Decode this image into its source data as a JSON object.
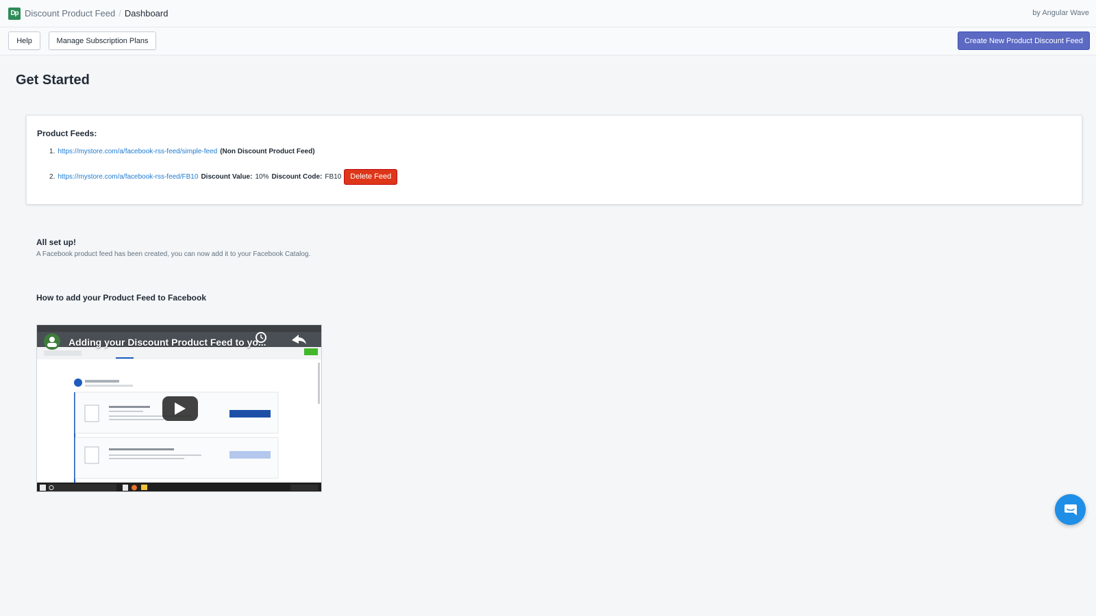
{
  "topbar": {
    "app_logo_text": "Dp",
    "app_name": "Discount Product Feed",
    "separator": "/",
    "current_page": "Dashboard",
    "byline": "by Angular Wave"
  },
  "toolbar": {
    "help_label": "Help",
    "plans_label": "Manage Subscription Plans",
    "create_label": "Create New Product Discount Feed"
  },
  "page": {
    "title": "Get Started"
  },
  "feeds_card": {
    "heading": "Product Feeds:",
    "feeds": [
      {
        "number": "1.",
        "url": "https://mystore.com/a/facebook-rss-feed/simple-feed",
        "note": "(Non Discount Product Feed)"
      },
      {
        "number": "2.",
        "url": "https://mystore.com/a/facebook-rss-feed/FB10",
        "discount_value_label": "Discount Value:",
        "discount_value": "10%",
        "discount_code_label": "Discount Code:",
        "discount_code": "FB10",
        "delete_label": "Delete Feed"
      }
    ]
  },
  "setup": {
    "title": "All set up!",
    "text": "A Facebook product feed has been created, you can now add it to your Facebook Catalog."
  },
  "howto": {
    "title": "How to add your Product Feed to Facebook"
  },
  "video": {
    "title": "Adding your Discount Product Feed to yo..."
  },
  "colors": {
    "primary": "#5c6ac4",
    "danger": "#de3618",
    "link": "#1e7bd1",
    "chat": "#1f8ee6"
  },
  "icons": [
    "app-logo-icon",
    "play-icon",
    "chat-icon",
    "avatar-icon",
    "clock-icon",
    "share-icon"
  ]
}
